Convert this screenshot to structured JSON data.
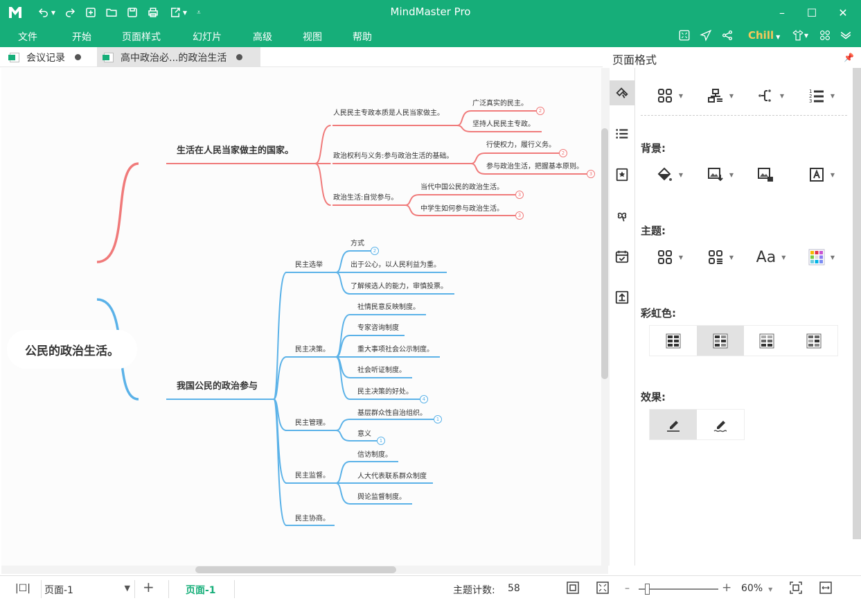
{
  "app": {
    "title": "MindMaster Pro",
    "theme_label": "Chill"
  },
  "colors": {
    "brand": "#16ae79",
    "branch_red": "#f07a7a",
    "branch_blue": "#5bb2e8",
    "chill": "#f7c85a"
  },
  "quick_access": [
    "logo-icon",
    "undo-icon",
    "redo-icon",
    "new-icon",
    "open-icon",
    "save-icon",
    "print-icon",
    "export-icon",
    "customize-icon"
  ],
  "window_controls": {
    "minimize": "–",
    "maximize": "☐",
    "close": "✕"
  },
  "menu": [
    "文件",
    "开始",
    "页面样式",
    "幻灯片",
    "高级",
    "视图",
    "帮助"
  ],
  "tabs": [
    {
      "label": "会议记录",
      "active": false
    },
    {
      "label": "高中政治必...的政治生活",
      "active": true
    }
  ],
  "mindmap": {
    "root": "公民的政治生活。",
    "branches": [
      {
        "label": "生活在人民当家做主的国家。",
        "children": [
          {
            "label": "人民民主专政本质是人民当家做主。",
            "children": [
              {
                "label": "广泛真实的民主。",
                "badge": "2"
              },
              {
                "label": "坚持人民民主专政。"
              }
            ]
          },
          {
            "label": "政治权利与义务:参与政治生活的基础。",
            "children": [
              {
                "label": "行使权力，履行义务。",
                "badge": "2"
              },
              {
                "label": "参与政治生活，把握基本原则。",
                "badge": "3"
              }
            ]
          },
          {
            "label": "政治生活:自觉参与。",
            "children": [
              {
                "label": "当代中国公民的政治生活。",
                "badge": "3"
              },
              {
                "label": "中学生如何参与政治生活。",
                "badge": "3"
              }
            ]
          }
        ]
      },
      {
        "label": "我国公民的政治参与",
        "children": [
          {
            "label": "民主选举",
            "children": [
              {
                "label": "方式",
                "badge": "2"
              },
              {
                "label": "出于公心，以人民利益为重。"
              },
              {
                "label": "了解候选人的能力，审慎投票。"
              }
            ]
          },
          {
            "label": "民主决策。",
            "children": [
              {
                "label": "社情民意反映制度。"
              },
              {
                "label": "专家咨询制度"
              },
              {
                "label": "重大事项社会公示制度。"
              },
              {
                "label": "社会听证制度。"
              },
              {
                "label": "民主决策的好处。",
                "badge": "4"
              }
            ]
          },
          {
            "label": "民主管理。",
            "children": [
              {
                "label": "基层群众性自治组织。",
                "badge": "1"
              },
              {
                "label": "意义",
                "badge": "1"
              }
            ]
          },
          {
            "label": "民主监督。",
            "children": [
              {
                "label": "信访制度。"
              },
              {
                "label": "人大代表联系群众制度"
              },
              {
                "label": "舆论监督制度。"
              }
            ]
          },
          {
            "label": "民主协商。",
            "children": []
          }
        ]
      }
    ]
  },
  "panel": {
    "title": "页面格式",
    "sections": {
      "background": "背景:",
      "theme": "主题:",
      "rainbow": "彩虹色:",
      "effect": "效果:"
    },
    "rail": [
      "page-format-icon",
      "outline-icon",
      "clipart-icon",
      "symbol-icon",
      "task-icon",
      "export-icon"
    ]
  },
  "status": {
    "page_select": "页面-1",
    "page_tab": "页面-1",
    "topic_count_label": "主题计数:",
    "topic_count": "58",
    "zoom": "60%",
    "zoom_fraction": 0.1
  }
}
